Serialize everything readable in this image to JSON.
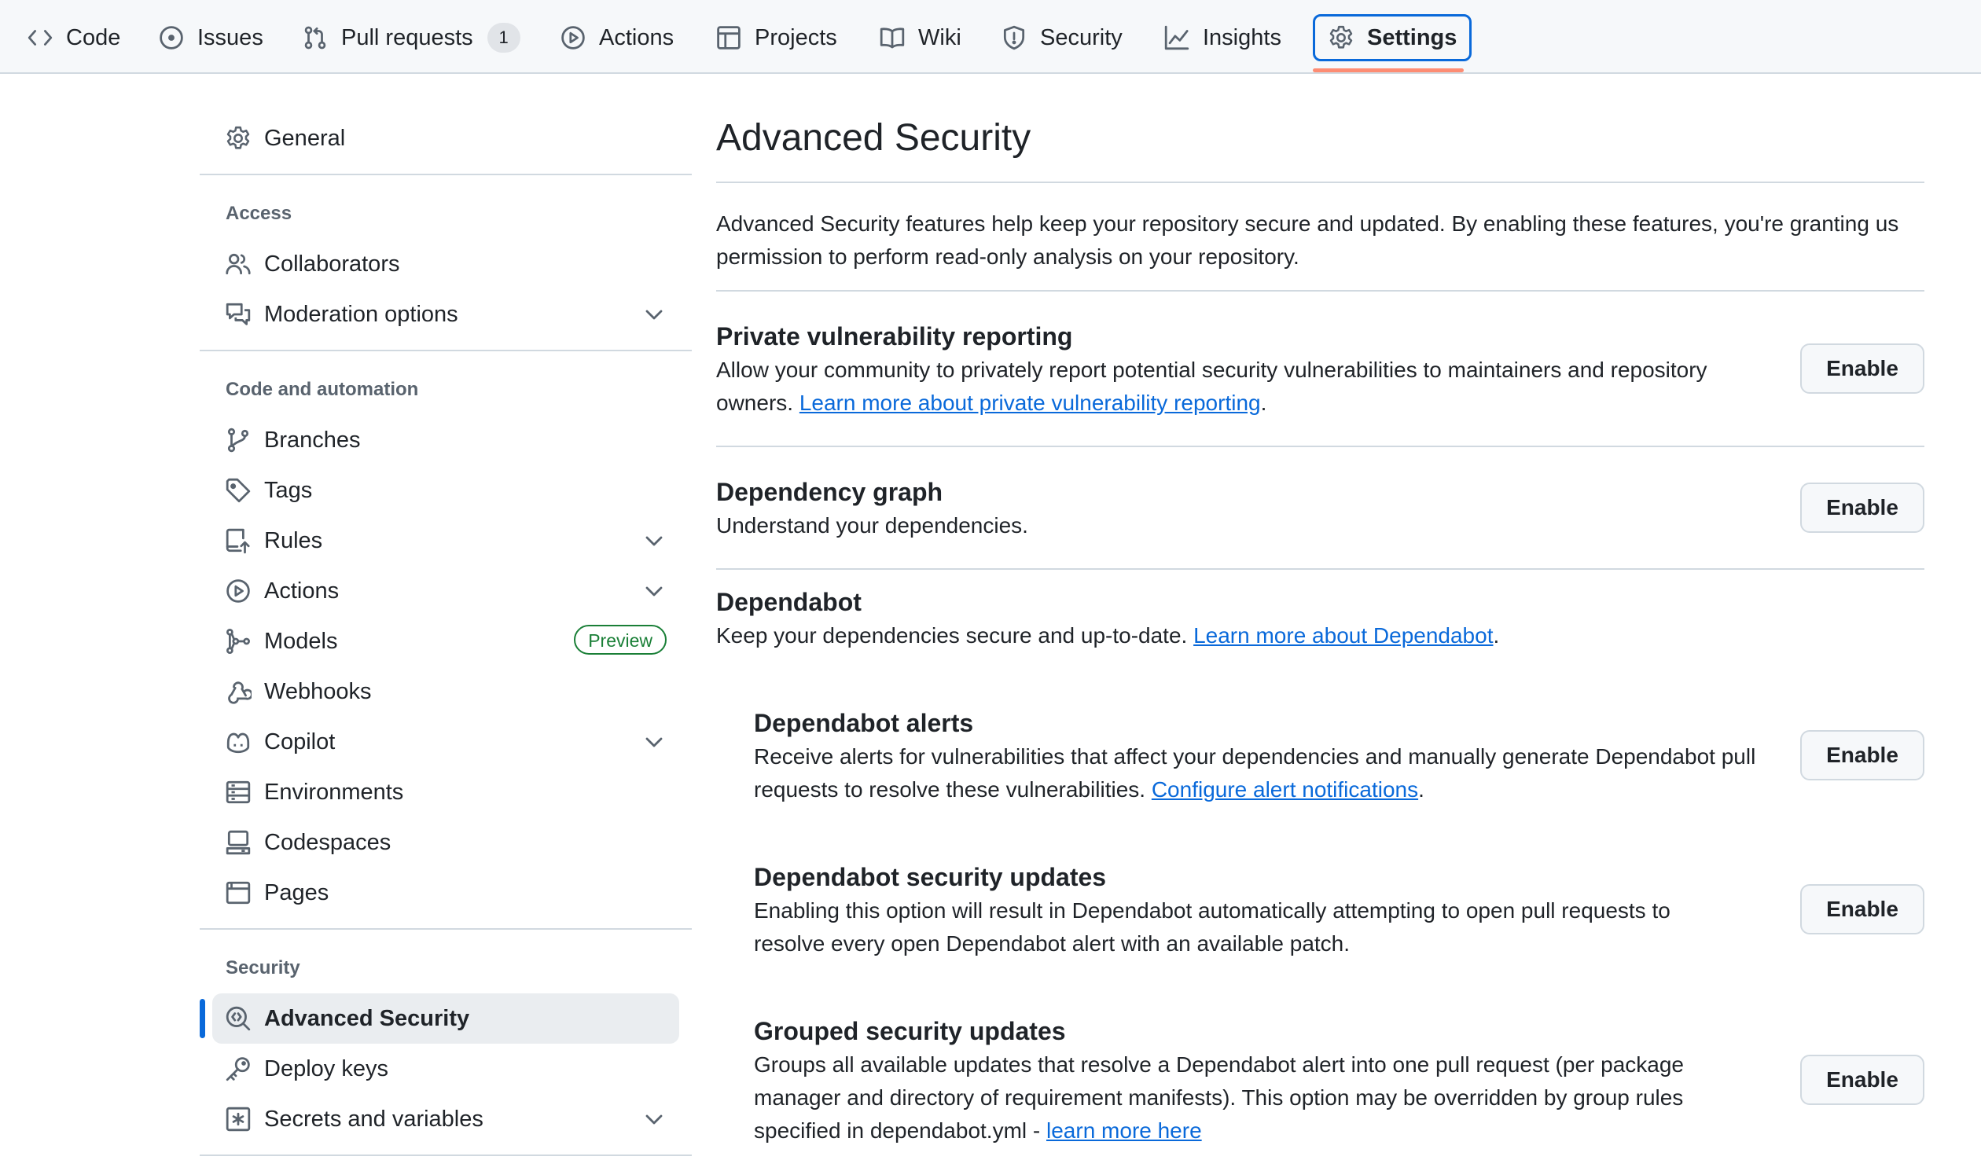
{
  "tabs": [
    {
      "label": "Code",
      "icon": "code-icon"
    },
    {
      "label": "Issues",
      "icon": "issue-opened-icon"
    },
    {
      "label": "Pull requests",
      "icon": "git-pull-request-icon",
      "count": "1"
    },
    {
      "label": "Actions",
      "icon": "play-icon"
    },
    {
      "label": "Projects",
      "icon": "table-icon"
    },
    {
      "label": "Wiki",
      "icon": "book-icon"
    },
    {
      "label": "Security",
      "icon": "shield-icon"
    },
    {
      "label": "Insights",
      "icon": "graph-icon"
    },
    {
      "label": "Settings",
      "icon": "gear-icon",
      "selected": true
    }
  ],
  "sidebar": {
    "general": "General",
    "headings": {
      "access": "Access",
      "code_automation": "Code and automation",
      "security": "Security"
    },
    "access_items": [
      {
        "label": "Collaborators",
        "icon": "people-icon"
      },
      {
        "label": "Moderation options",
        "icon": "comment-discussion-icon",
        "expandable": true
      }
    ],
    "code_items": [
      {
        "label": "Branches",
        "icon": "git-branch-icon"
      },
      {
        "label": "Tags",
        "icon": "tag-icon"
      },
      {
        "label": "Rules",
        "icon": "repo-push-icon",
        "expandable": true
      },
      {
        "label": "Actions",
        "icon": "play-icon",
        "expandable": true
      },
      {
        "label": "Models",
        "icon": "ai-model-icon",
        "badge": "Preview"
      },
      {
        "label": "Webhooks",
        "icon": "webhook-icon"
      },
      {
        "label": "Copilot",
        "icon": "copilot-icon",
        "expandable": true
      },
      {
        "label": "Environments",
        "icon": "server-icon"
      },
      {
        "label": "Codespaces",
        "icon": "codespaces-icon"
      },
      {
        "label": "Pages",
        "icon": "browser-icon"
      }
    ],
    "security_items": [
      {
        "label": "Advanced Security",
        "icon": "codescan-icon",
        "active": true
      },
      {
        "label": "Deploy keys",
        "icon": "key-icon"
      },
      {
        "label": "Secrets and variables",
        "icon": "key-asterisk-icon",
        "expandable": true
      }
    ]
  },
  "main": {
    "title": "Advanced Security",
    "intro": "Advanced Security features help keep your repository secure and updated. By enabling these features, you're granting us permission to perform read-only analysis on your repository.",
    "enable_label": "Enable",
    "features": {
      "pvr": {
        "title": "Private vulnerability reporting",
        "desc": "Allow your community to privately report potential security vulnerabilities to maintainers and repository owners. ",
        "link": "Learn more about private vulnerability reporting",
        "after": "."
      },
      "depgraph": {
        "title": "Dependency graph",
        "desc": "Understand your dependencies."
      },
      "dependabot": {
        "title": "Dependabot",
        "desc": "Keep your dependencies secure and up-to-date. ",
        "link": "Learn more about Dependabot",
        "after": "."
      },
      "alerts": {
        "title": "Dependabot alerts",
        "desc": "Receive alerts for vulnerabilities that affect your dependencies and manually generate Dependabot pull requests to resolve these vulnerabilities. ",
        "link": "Configure alert notifications",
        "after": "."
      },
      "secupdates": {
        "title": "Dependabot security updates",
        "desc": "Enabling this option will result in Dependabot automatically attempting to open pull requests to resolve every open Dependabot alert with an available patch."
      },
      "grouped": {
        "title": "Grouped security updates",
        "desc": "Groups all available updates that resolve a Dependabot alert into one pull request (per package manager and directory of requirement manifests). This option may be overridden by group rules specified in dependabot.yml - ",
        "link": "learn more here"
      }
    }
  },
  "colors": {
    "accent": "#0969da",
    "tab_underline": "#fd8c73",
    "preview_badge": "#1a7f37",
    "border": "#d1d9e0"
  }
}
